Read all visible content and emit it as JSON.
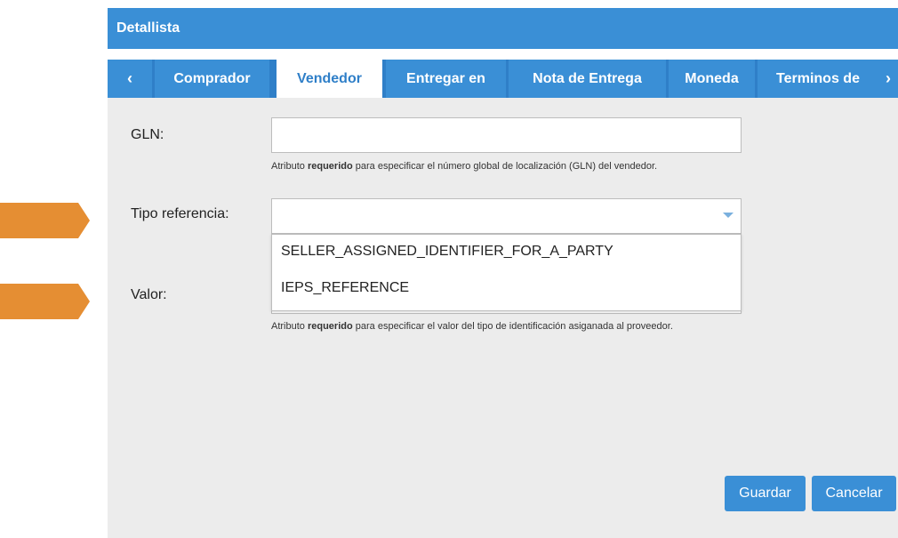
{
  "dialog": {
    "title": "Detallista",
    "tabs": [
      {
        "label": "‹",
        "kind": "nav"
      },
      {
        "label": "Comprador"
      },
      {
        "label": "Vendedor",
        "active": true
      },
      {
        "label": "Entregar en"
      },
      {
        "label": "Nota de Entrega"
      },
      {
        "label": "Moneda"
      },
      {
        "label": "Terminos de"
      },
      {
        "label": "›",
        "kind": "nav"
      }
    ]
  },
  "form": {
    "gln": {
      "label": "GLN:",
      "value": "",
      "help_pre": "Atributo ",
      "help_bold": "requerido",
      "help_post": " para especificar el número global de localización (GLN) del vendedor."
    },
    "tipo_referencia": {
      "label": "Tipo referencia:",
      "value": "",
      "options": [
        "SELLER_ASSIGNED_IDENTIFIER_FOR_A_PARTY",
        "IEPS_REFERENCE"
      ]
    },
    "valor": {
      "label": "Valor:",
      "value": "",
      "help_pre": "Atributo ",
      "help_bold": "requerido",
      "help_post": " para especificar el valor del tipo de identificación asiganada al proveedor."
    }
  },
  "buttons": {
    "save": "Guardar",
    "cancel": "Cancelar"
  },
  "colors": {
    "accent": "#3a8fd6",
    "annotation_arrow": "#e58e33"
  }
}
